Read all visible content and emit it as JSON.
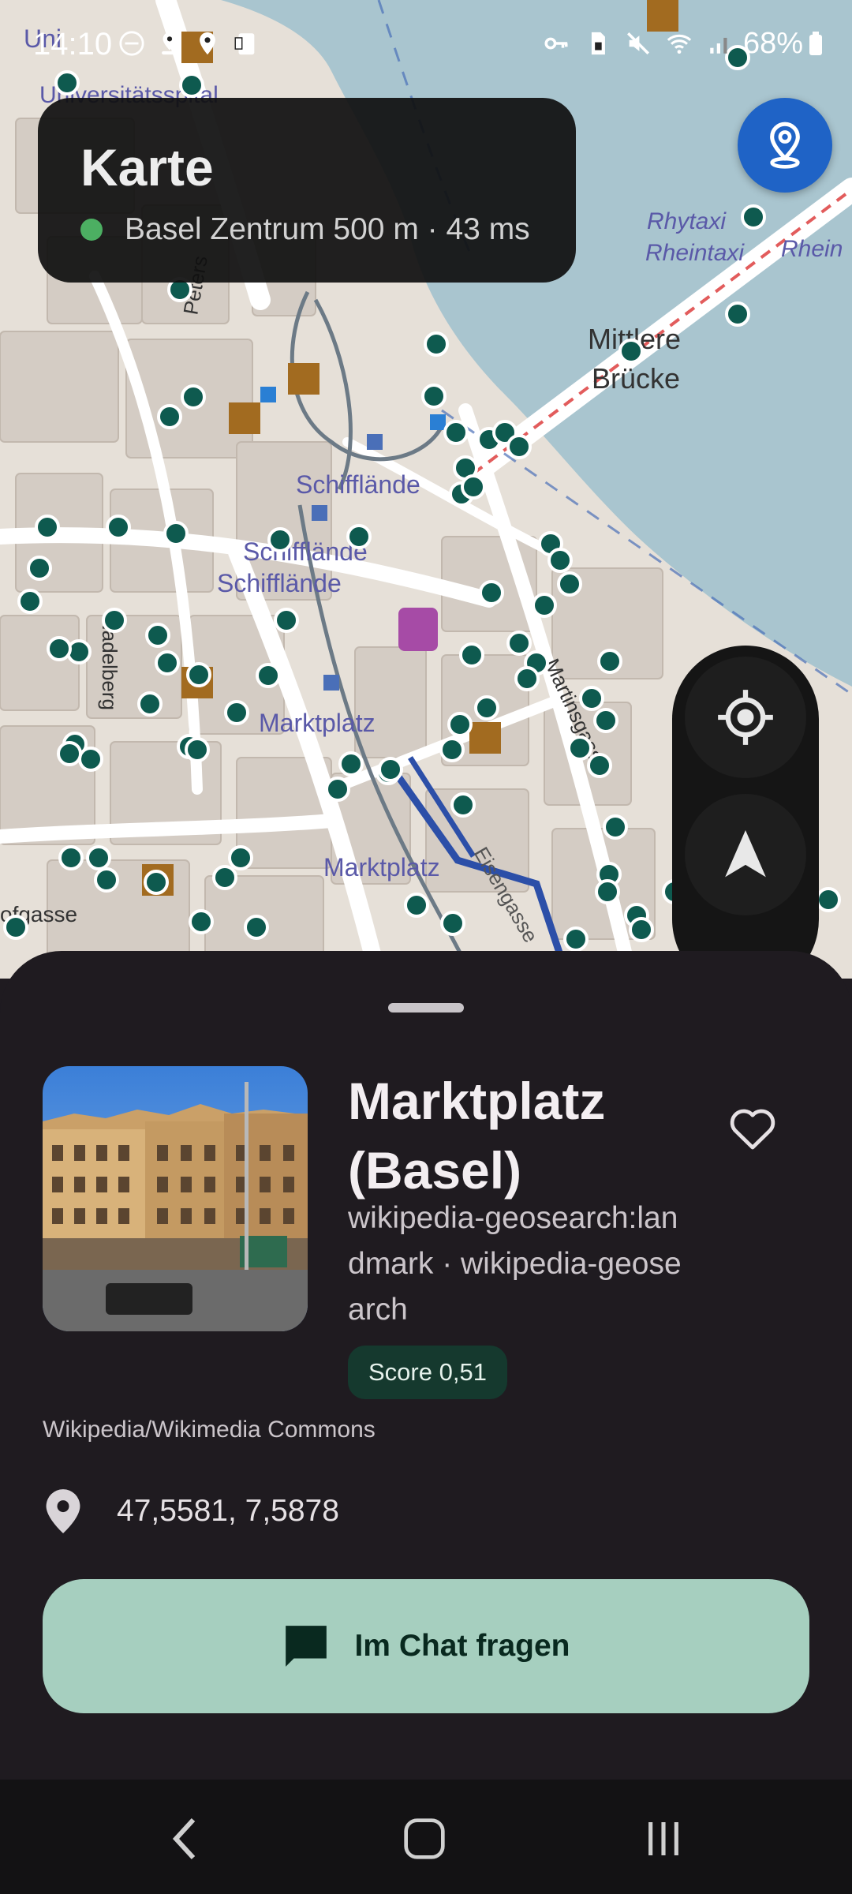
{
  "status_bar": {
    "time": "14:10",
    "battery": "68%",
    "left_icons": [
      "dnd-icon",
      "location-person-icon",
      "location-pin-icon",
      "clipboard-icon"
    ],
    "right_icons": [
      "key-icon",
      "sim-icon",
      "mute-icon",
      "wifi-icon",
      "signal-icon"
    ]
  },
  "map": {
    "labels": {
      "universitaetsspital": "Universitätsspital",
      "rhytaxi": "Rhytaxi",
      "rheintaxi": "Rheintaxi",
      "rhein": "Rhein",
      "mittlere": "Mittlere",
      "bruecke": "Brücke",
      "schifflaende1": "Schifflände",
      "schifflaende2": "Schifflände",
      "schifflaende3": "Schifflände",
      "marktplatz1": "Marktplatz",
      "marktplatz2": "Marktplatz",
      "nadelberg": "Nadelberg",
      "martinsgasse": "Martinsgasse",
      "hofgasse": "ofgasse",
      "petersgraben": "Peters",
      "eisengasse": "Eisengasse",
      "unispital_short": "Uni"
    }
  },
  "header_card": {
    "title": "Karte",
    "status": "Basel Zentrum 500 m · 43 ms",
    "status_color": "#4caf62"
  },
  "place": {
    "title": "Marktplatz (Basel)",
    "source": "wikipedia-geosearch:landmark · wikipedia-geosearch",
    "score": "Score 0,51",
    "attribution": "Wikipedia/Wikimedia Commons",
    "coordinates": "47,5581, 7,5878"
  },
  "actions": {
    "chat_button": "Im Chat fragen"
  },
  "colors": {
    "accent": "#1f63c6",
    "button": "#a6cfbf",
    "marker": "#0e5a4f",
    "sheet": "#1f1b20"
  }
}
